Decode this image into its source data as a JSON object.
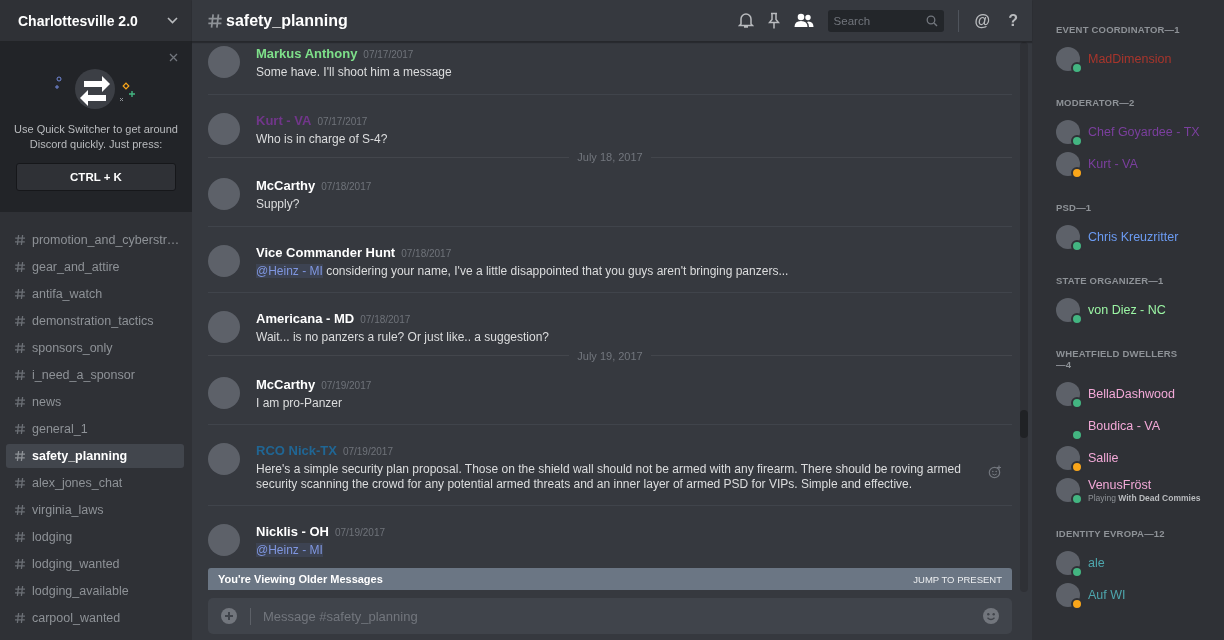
{
  "sidebar": {
    "server_name": "Charlottesville 2.0",
    "quick_switcher": {
      "message": "Use Quick Switcher to get around Discord quickly. Just press:",
      "shortcut": "CTRL + K"
    },
    "channels": [
      {
        "name": "promotion_and_cyberstr…",
        "selected": false
      },
      {
        "name": "gear_and_attire",
        "selected": false
      },
      {
        "name": "antifa_watch",
        "selected": false
      },
      {
        "name": "demonstration_tactics",
        "selected": false
      },
      {
        "name": "sponsors_only",
        "selected": false
      },
      {
        "name": "i_need_a_sponsor",
        "selected": false
      },
      {
        "name": "news",
        "selected": false
      },
      {
        "name": "general_1",
        "selected": false
      },
      {
        "name": "safety_planning",
        "selected": true
      },
      {
        "name": "alex_jones_chat",
        "selected": false
      },
      {
        "name": "virginia_laws",
        "selected": false
      },
      {
        "name": "lodging",
        "selected": false
      },
      {
        "name": "lodging_wanted",
        "selected": false
      },
      {
        "name": "lodging_available",
        "selected": false
      },
      {
        "name": "carpool_wanted",
        "selected": false
      }
    ]
  },
  "header": {
    "channel": "safety_planning",
    "members_toggle_on": true,
    "search": {
      "placeholder": "Search"
    },
    "mention_button": "@",
    "help_button": "?"
  },
  "messages": [
    {
      "kind": "message",
      "author": "Markus Anthony",
      "color": "#7ee08a",
      "time": "07/17/2017",
      "text": "Some have.  I'll shoot him a message"
    },
    {
      "kind": "message",
      "author": "Kurt - VA",
      "color": "#71368a",
      "time": "07/17/2017",
      "text": "Who is in charge of S-4?"
    },
    {
      "kind": "date_divider",
      "text": "July 18, 2017"
    },
    {
      "kind": "message",
      "author": "McCarthy",
      "color": "#ffffff",
      "time": "07/18/2017",
      "text": "Supply?"
    },
    {
      "kind": "message",
      "author": "Vice Commander Hunt",
      "color": "#ffffff",
      "time": "07/18/2017",
      "mention": "@Heinz - MI",
      "text": " considering your name, I've a little disappointed that you guys aren't bringing panzers..."
    },
    {
      "kind": "message",
      "author": "Americana - MD",
      "color": "#ffffff",
      "time": "07/18/2017",
      "text": "Wait... is no panzers a rule? Or just like.. a suggestion?"
    },
    {
      "kind": "date_divider",
      "text": "July 19, 2017"
    },
    {
      "kind": "message",
      "author": "McCarthy",
      "color": "#ffffff",
      "time": "07/19/2017",
      "text": "I am pro-Panzer"
    },
    {
      "kind": "message",
      "author": "RCO Nick-TX",
      "color": "#206694",
      "time": "07/19/2017",
      "text": "Here's a simple security plan proposal. Those on the shield wall should not be armed with any firearm. There should be roving armed security scanning the crowd for any potential armed threats and an inner layer of armed PSD for VIPs. Simple and effective.",
      "hovered": true
    },
    {
      "kind": "message",
      "author": "Nicklis - OH",
      "color": "#ffffff",
      "time": "07/19/2017",
      "mention": "@Heinz - MI"
    }
  ],
  "older_banner": {
    "text": "You're Viewing Older Messages",
    "action": "JUMP TO PRESENT"
  },
  "composer": {
    "placeholder": "Message #safety_planning"
  },
  "members": [
    {
      "title": "EVENT COORDINATOR—1",
      "members": [
        {
          "name": "MadDimension",
          "color": "#a8352c",
          "idle": false,
          "avatar": true
        }
      ]
    },
    {
      "title": "MODERATOR—2",
      "members": [
        {
          "name": "Chef Goyardee - TX",
          "color": "#7b3f9e",
          "idle": false,
          "avatar": true
        },
        {
          "name": "Kurt - VA",
          "color": "#7b3f9e",
          "idle": true,
          "avatar": true
        }
      ]
    },
    {
      "title": "PSD—1",
      "members": [
        {
          "name": "Chris Kreuzritter",
          "color": "#6b9bf2",
          "idle": false,
          "avatar": true
        }
      ]
    },
    {
      "title": "STATE ORGANIZER—1",
      "members": [
        {
          "name": "von Diez - NC",
          "color": "#9bf5a4",
          "idle": false,
          "avatar": true
        }
      ]
    },
    {
      "title": "WHEATFIELD DWELLERS—4",
      "members": [
        {
          "name": "BellaDashwood",
          "color": "#f3a9d8",
          "idle": false,
          "avatar": true
        },
        {
          "name": "Boudica - VA",
          "color": "#f3a9d8",
          "idle": false,
          "avatar": false
        },
        {
          "name": "Sallie",
          "color": "#f3a9d8",
          "idle": true,
          "avatar": true
        },
        {
          "name": "VenusFröst",
          "color": "#f3a9d8",
          "idle": false,
          "avatar": true,
          "activity": "Playing **With Dead Commies**"
        }
      ]
    },
    {
      "title": "IDENTITY EVROPA—12",
      "members": [
        {
          "name": "ale",
          "color": "#4ea6ad",
          "idle": false,
          "avatar": true
        },
        {
          "name": "Auf WI",
          "color": "#4ea6ad",
          "idle": true,
          "avatar": true
        }
      ]
    }
  ]
}
